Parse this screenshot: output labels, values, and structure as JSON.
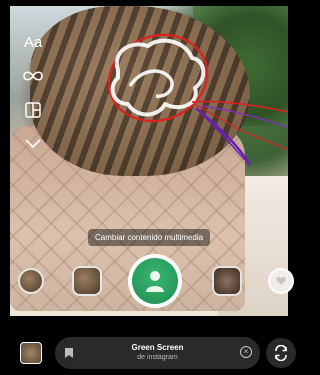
{
  "camera": {
    "side_tools": [
      {
        "icon": "text-icon",
        "label": "Aa"
      },
      {
        "icon": "boomerang-icon"
      },
      {
        "icon": "layout-icon"
      },
      {
        "icon": "chevron-down-icon"
      }
    ]
  },
  "tooltip": {
    "text": "Cambiar contenido multimedia"
  },
  "effects": {
    "active": "green-screen",
    "thumbs": [
      "effect-left-1",
      "effect-left-2",
      "effect-right-1",
      "effect-right-2"
    ]
  },
  "bottom": {
    "effect_name": "Green Screen",
    "effect_source": "de instagram",
    "icons": [
      "gallery-thumbnail",
      "bookmark-icon",
      "close-icon",
      "flip-camera-icon"
    ]
  },
  "colors": {
    "drawing_white": "#ffffff",
    "drawing_red": "#e0201c",
    "drawing_purple": "#6a1fb0",
    "capture_green": "#2ea862"
  }
}
